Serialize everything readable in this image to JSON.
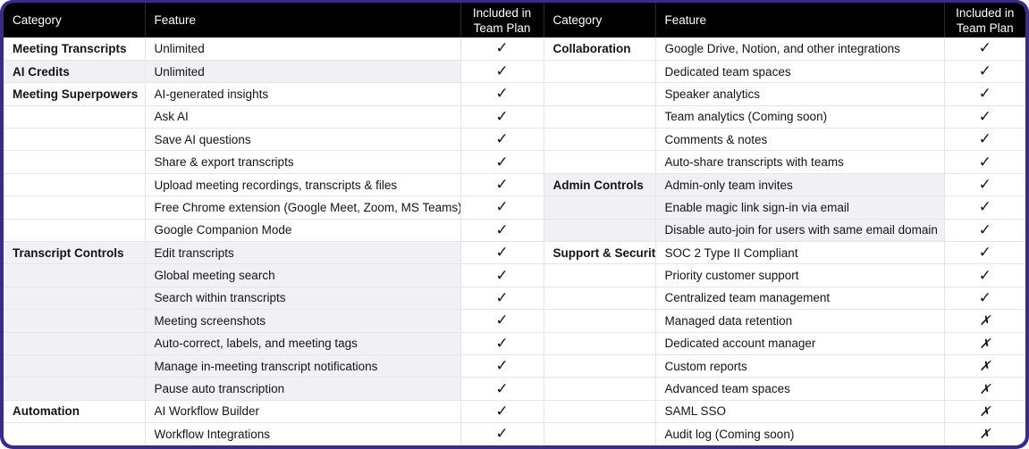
{
  "headers": {
    "category": "Category",
    "feature": "Feature",
    "included": [
      "Included in",
      "Team Plan"
    ]
  },
  "glyphs": {
    "yes": "✓",
    "no": "✗"
  },
  "left": [
    {
      "category": "Meeting Transcripts",
      "feature": "Unlimited",
      "included": true
    },
    {
      "category": "AI Credits",
      "feature": "Unlimited",
      "included": true
    },
    {
      "category": "Meeting Superpowers",
      "feature": "AI-generated insights",
      "included": true
    },
    {
      "category": "",
      "feature": "Ask AI",
      "included": true
    },
    {
      "category": "",
      "feature": "Save AI questions",
      "included": true
    },
    {
      "category": "",
      "feature": "Share & export transcripts",
      "included": true
    },
    {
      "category": "",
      "feature": "Upload meeting recordings, transcripts & files",
      "included": true
    },
    {
      "category": "",
      "feature": "Free Chrome extension (Google Meet, Zoom, MS Teams)",
      "included": true
    },
    {
      "category": "",
      "feature": "Google Companion Mode",
      "included": true
    },
    {
      "category": "Transcript Controls",
      "feature": "Edit transcripts",
      "included": true
    },
    {
      "category": "",
      "feature": "Global meeting search",
      "included": true
    },
    {
      "category": "",
      "feature": "Search within transcripts",
      "included": true
    },
    {
      "category": "",
      "feature": "Meeting screenshots",
      "included": true
    },
    {
      "category": "",
      "feature": "Auto-correct, labels, and meeting tags",
      "included": true
    },
    {
      "category": "",
      "feature": "Manage in-meeting transcript notifications",
      "included": true
    },
    {
      "category": "",
      "feature": "Pause auto transcription",
      "included": true
    },
    {
      "category": "Automation",
      "feature": "AI Workflow Builder",
      "included": true
    },
    {
      "category": "",
      "feature": "Workflow Integrations",
      "included": true
    }
  ],
  "right": [
    {
      "category": "Collaboration",
      "feature": "Google Drive, Notion, and other integrations",
      "included": true
    },
    {
      "category": "",
      "feature": "Dedicated team spaces",
      "included": true
    },
    {
      "category": "",
      "feature": "Speaker analytics",
      "included": true
    },
    {
      "category": "",
      "feature": "Team analytics (Coming soon)",
      "included": true
    },
    {
      "category": "",
      "feature": "Comments & notes",
      "included": true
    },
    {
      "category": "",
      "feature": "Auto-share transcripts with teams",
      "included": true
    },
    {
      "category": "Admin Controls",
      "feature": "Admin-only team invites",
      "included": true
    },
    {
      "category": "",
      "feature": "Enable magic link sign-in via email",
      "included": true
    },
    {
      "category": "",
      "feature": "Disable auto-join for users with same email domain",
      "included": true
    },
    {
      "category": "Support & Security",
      "feature": "SOC 2 Type II Compliant",
      "included": true
    },
    {
      "category": "",
      "feature": "Priority customer support",
      "included": true
    },
    {
      "category": "",
      "feature": "Centralized team management",
      "included": true
    },
    {
      "category": "",
      "feature": "Managed data retention",
      "included": false
    },
    {
      "category": "",
      "feature": "Dedicated account manager",
      "included": false
    },
    {
      "category": "",
      "feature": "Custom reports",
      "included": false
    },
    {
      "category": "",
      "feature": "Advanced team spaces",
      "included": false
    },
    {
      "category": "",
      "feature": "SAML SSO",
      "included": false
    },
    {
      "category": "",
      "feature": "Audit log (Coming soon)",
      "included": false
    }
  ]
}
